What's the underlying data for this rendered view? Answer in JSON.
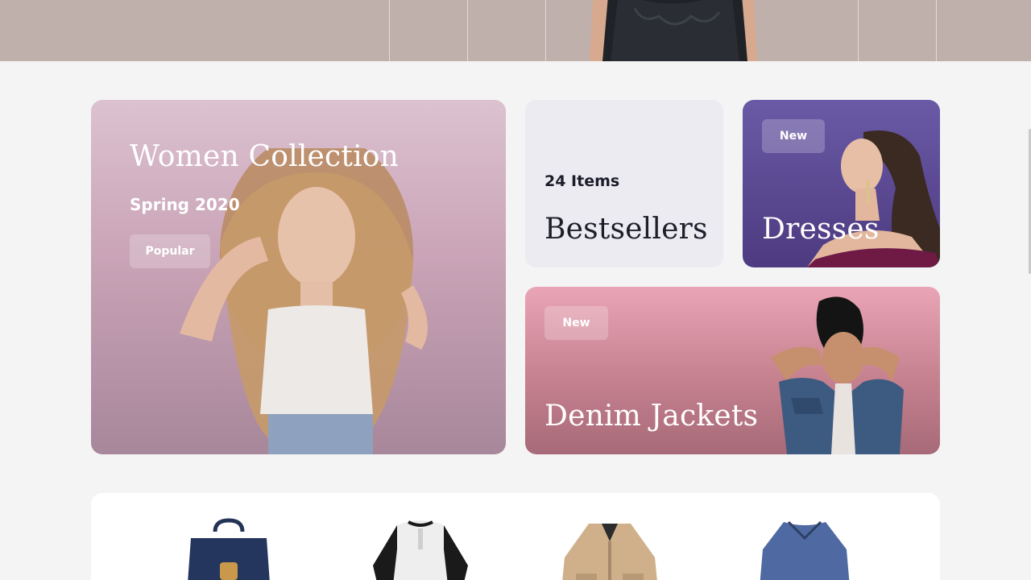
{
  "hero": {},
  "collections": {
    "women": {
      "title": "Women Collection",
      "subtitle": "Spring 2020",
      "badge": "Popular"
    },
    "bestsellers": {
      "count": "24 Items",
      "title": "Bestsellers"
    },
    "dresses": {
      "badge": "New",
      "title": "Dresses"
    },
    "denim": {
      "badge": "New",
      "title": "Denim Jackets"
    }
  },
  "products": {
    "items": [
      {
        "icon": "backpack-icon"
      },
      {
        "icon": "raglan-shirt-icon"
      },
      {
        "icon": "jacket-icon"
      },
      {
        "icon": "sweater-icon"
      }
    ]
  },
  "colors": {
    "page_bg": "#f4f4f5",
    "dresses_card": "#5b4a95",
    "denim_card": "#d48fa0",
    "bestsellers_card": "#ecebf1",
    "dark_text": "#1d1e2c"
  }
}
